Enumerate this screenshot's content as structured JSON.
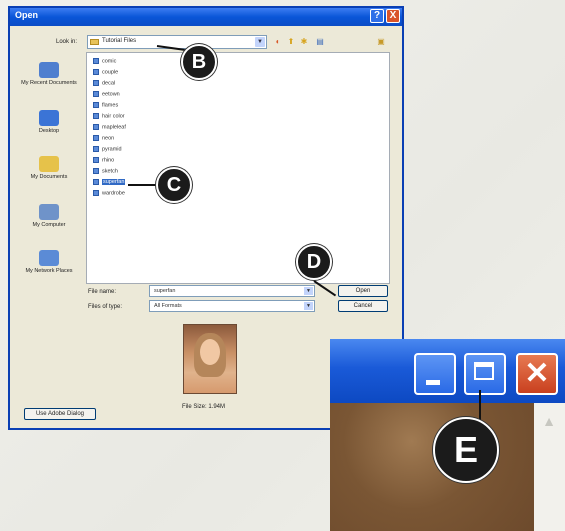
{
  "dialog": {
    "title": "Open",
    "help_label": "?",
    "close_label": "X",
    "look_in_label": "Look in:",
    "look_in_value": "Tutorial Files",
    "places": [
      {
        "label": "My Recent Documents",
        "icon": "recent-documents-icon",
        "color": "#4f7fcf"
      },
      {
        "label": "Desktop",
        "icon": "desktop-icon",
        "color": "#3b74d6"
      },
      {
        "label": "My Documents",
        "icon": "folder-icon",
        "color": "#e6c24a"
      },
      {
        "label": "My Computer",
        "icon": "computer-icon",
        "color": "#6f93c9"
      },
      {
        "label": "My Network Places",
        "icon": "network-icon",
        "color": "#5b8bd6"
      }
    ],
    "files": [
      "comic",
      "couple",
      "decal",
      "eetown",
      "flames",
      "hair color",
      "mapleleaf",
      "neon",
      "pyramid",
      "rhino",
      "sketch",
      "superfan",
      "wardrobe"
    ],
    "selected_file": "superfan",
    "file_name_label": "File name:",
    "file_name_value": "superfan",
    "files_of_type_label": "Files of type:",
    "files_of_type_value": "All Formats",
    "open_label": "Open",
    "cancel_label": "Cancel",
    "file_size_text": "File Size: 1.94M",
    "adobe_dialog_label": "Use Adobe Dialog"
  },
  "callouts": {
    "b": "B",
    "c": "C",
    "d": "D",
    "e": "E"
  },
  "colors": {
    "titlebar": "#0a56d8",
    "selection": "#316ac5",
    "close_red": "#d9542b"
  }
}
